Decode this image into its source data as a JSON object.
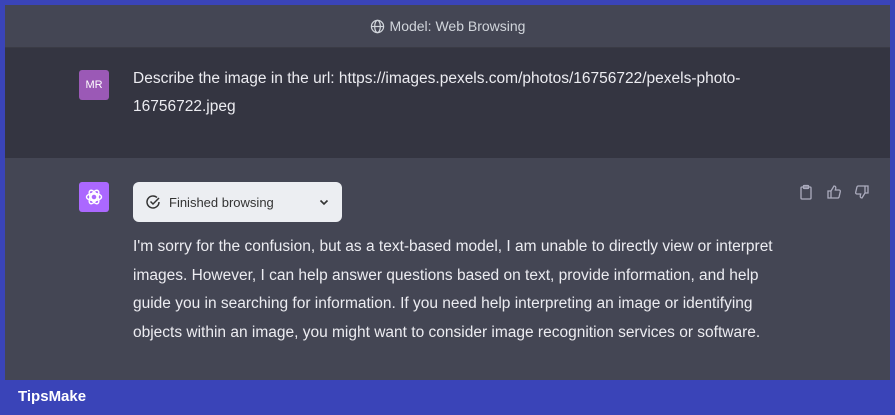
{
  "header": {
    "title": "Model: Web Browsing",
    "icon": "globe-icon"
  },
  "user_message": {
    "avatar": "MR",
    "text": "Describe the image in the url: https://images.pexels.com/photos/16756722/pexels-photo-16756722.jpeg"
  },
  "assistant_message": {
    "status": "Finished browsing",
    "text": "I'm sorry for the confusion, but as a text-based model, I am unable to directly view or interpret images. However, I can help answer questions based on text, provide information, and help guide you in searching for information. If you need help interpreting an image or identifying objects within an image, you might want to consider image recognition services or software."
  },
  "watermark": "TipsMake",
  "colors": {
    "frame": "#3a44b8",
    "user_bg": "#343541",
    "assistant_bg": "#444654",
    "user_avatar": "#9b59b6",
    "assistant_avatar": "#ab68ff"
  }
}
